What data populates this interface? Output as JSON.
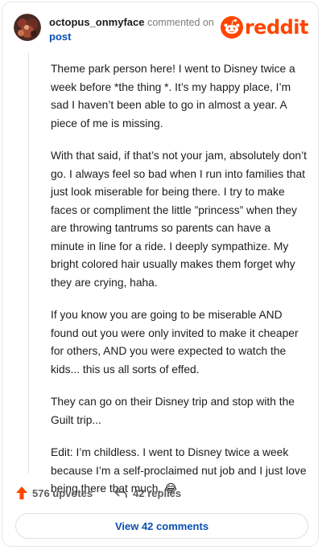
{
  "header": {
    "username": "octopus_onmyface",
    "commented_text": "commented on",
    "post_link": "post",
    "brand": "reddit",
    "avatar_icon": "user-avatar-icon",
    "brand_icon": "reddit-snoo-icon"
  },
  "comment": {
    "paragraphs": [
      "Theme park person here! I went to Disney twice a week before *the thing *. It’s my happy place, I’m sad I haven’t been able to go in almost a year. A piece of me is missing.",
      "With that said, if that’s not your jam, absolutely don’t go. I always feel so bad when I run into families that just look miserable for being there. I try to make faces or compliment the little ”princess” when they are throwing tantrums so parents can have a minute in line for a ride. I deeply sympathize. My bright colored hair usually makes them forget why they are crying, haha.",
      "If you know you are going to be miserable AND found out you were only invited to make it cheaper for others, AND you were expected to watch the kids... this us all sorts of effed.",
      "They can go on their Disney trip and stop with the Guilt trip...",
      "Edit: I’m childless. I went to Disney twice a week because I’m a self-proclaimed nut job and I just love being there that much. 😂"
    ]
  },
  "footer": {
    "upvotes": "576 upvotes",
    "replies": "42 replies",
    "view_comments": "View 42 comments",
    "upvote_icon": "upvote-arrow-icon",
    "reply_icon": "reply-arrow-icon"
  },
  "colors": {
    "brand": "#ff4500",
    "link": "#0a4fb0",
    "muted": "#7c7c7c"
  }
}
